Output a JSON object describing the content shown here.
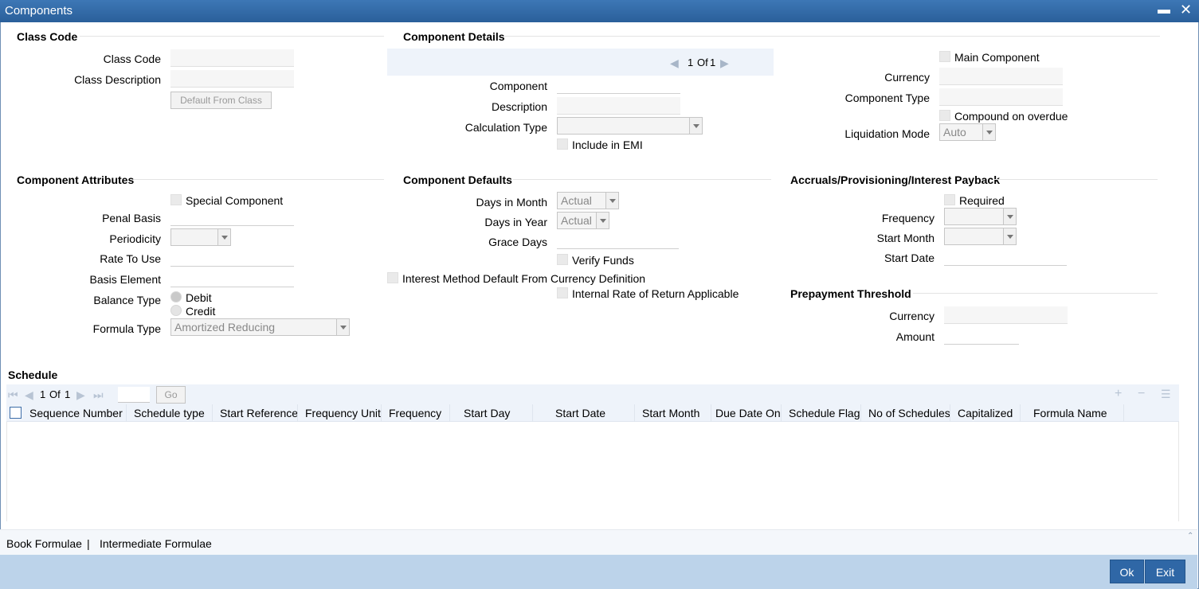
{
  "window": {
    "title": "Components"
  },
  "class_code": {
    "section_title": "Class Code",
    "class_code_label": "Class Code",
    "class_description_label": "Class Description",
    "default_button": "Default From Class"
  },
  "component_details": {
    "section_title": "Component Details",
    "nav": {
      "page": "1",
      "of_label": "Of",
      "total": "1"
    },
    "component_label": "Component",
    "description_label": "Description",
    "calculation_type_label": "Calculation Type",
    "include_emi_label": "Include in EMI",
    "main_component_label": "Main Component",
    "currency_label": "Currency",
    "component_type_label": "Component Type",
    "compound_overdue_label": "Compound on overdue",
    "liquidation_mode_label": "Liquidation Mode",
    "liquidation_mode_value": "Auto"
  },
  "component_attributes": {
    "section_title": "Component Attributes",
    "special_component_label": "Special Component",
    "penal_basis_label": "Penal Basis",
    "periodicity_label": "Periodicity",
    "rate_to_use_label": "Rate To Use",
    "basis_element_label": "Basis Element",
    "balance_type_label": "Balance Type",
    "debit_label": "Debit",
    "credit_label": "Credit",
    "formula_type_label": "Formula Type",
    "formula_type_value": "Amortized Reducing"
  },
  "component_defaults": {
    "section_title": "Component Defaults",
    "days_in_month_label": "Days in Month",
    "days_in_month_value": "Actual",
    "days_in_year_label": "Days in Year",
    "days_in_year_value": "Actual",
    "grace_days_label": "Grace Days",
    "verify_funds_label": "Verify Funds",
    "interest_method_label": "Interest Method Default From Currency Definition",
    "irr_label": "Internal Rate of Return Applicable"
  },
  "accruals": {
    "section_title": "Accruals/Provisioning/Interest Payback",
    "required_label": "Required",
    "frequency_label": "Frequency",
    "start_month_label": "Start Month",
    "start_date_label": "Start Date"
  },
  "prepayment": {
    "section_title": "Prepayment Threshold",
    "currency_label": "Currency",
    "amount_label": "Amount"
  },
  "schedule": {
    "section_title": "Schedule",
    "nav": {
      "page": "1",
      "of_label": "Of",
      "total": "1"
    },
    "go_button": "Go",
    "columns": [
      "Sequence Number",
      "Schedule type",
      "Start Reference",
      "Frequency Unit",
      "Frequency",
      "Start Day",
      "Start Date",
      "Start Month",
      "Due Date On",
      "Schedule Flag",
      "No of Schedules",
      "Capitalized",
      "Formula Name"
    ]
  },
  "footer": {
    "book_formulae": "Book Formulae",
    "separator": "|",
    "intermediate_formulae": "Intermediate Formulae",
    "ok_button": "Ok",
    "exit_button": "Exit"
  }
}
